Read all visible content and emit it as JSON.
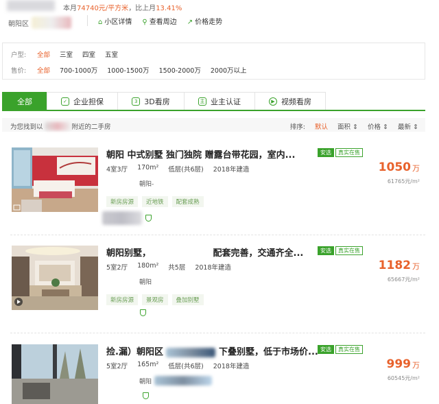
{
  "header": {
    "price_line": {
      "prefix": "本月",
      "value": "74740元/平方米",
      "mid": "，比上月",
      "change": "13.41%"
    },
    "district": "朝阳区",
    "links": [
      {
        "icon": "house-icon",
        "label": "小区详情"
      },
      {
        "icon": "pin-icon",
        "label": "查看周边"
      },
      {
        "icon": "trend-icon",
        "label": "价格走势"
      }
    ]
  },
  "filters": {
    "layout": {
      "label": "户型:",
      "options": [
        "全部",
        "三室",
        "四室",
        "五室"
      ],
      "selected": 0
    },
    "price": {
      "label": "售价:",
      "options": [
        "全部",
        "700-1000万",
        "1000-1500万",
        "1500-2000万",
        "2000万以上"
      ],
      "selected": 0
    }
  },
  "tabs": [
    {
      "label": "全部",
      "icon": ""
    },
    {
      "label": "企业担保",
      "icon": "shield-icon"
    },
    {
      "label": "3D看房",
      "icon": "cube-icon"
    },
    {
      "label": "业主认证",
      "icon": "owner-icon"
    },
    {
      "label": "视频看房",
      "icon": "play-icon"
    }
  ],
  "result_bar": {
    "prefix": "为您找到以",
    "suffix": "附近的二手房",
    "sort_label": "排序:",
    "sorts": [
      "默认",
      "面积",
      "价格",
      "最新"
    ],
    "active_sort": 0
  },
  "listings": [
    {
      "title": "朝阳 中式别墅 独门独院 赠露台带花园，室内...",
      "badges": [
        "安选",
        "真实在售"
      ],
      "attrs": [
        "4室3厅",
        "170m²",
        "低层(共6层)",
        "2018年建造"
      ],
      "community": "朝阳-",
      "tags": [
        "新房房源",
        "近地铁",
        "配套成熟"
      ],
      "price": "1050",
      "price_unit": "万",
      "unit_price": "61765元/m²"
    },
    {
      "title": "朝阳别墅，                    配套完善，交通齐全...",
      "badges": [
        "安选",
        "真实在售"
      ],
      "attrs": [
        "5室2厅",
        "180m²",
        "共5层",
        "2018年建造"
      ],
      "community": "朝阳",
      "tags": [
        "新房房源",
        "景观房",
        "叠加别墅"
      ],
      "price": "1182",
      "price_unit": "万",
      "unit_price": "65667元/m²"
    },
    {
      "title": "捡.漏）朝阳区",
      "title_tail": "下叠别墅，低于市场价...",
      "badges": [
        "安选",
        "真实在售"
      ],
      "attrs": [
        "5室2厅",
        "165m²",
        "低层(共6层)",
        "2018年建造"
      ],
      "community": "朝阳",
      "tags": [],
      "price": "999",
      "price_unit": "万",
      "unit_price": "60545元/m²"
    }
  ]
}
